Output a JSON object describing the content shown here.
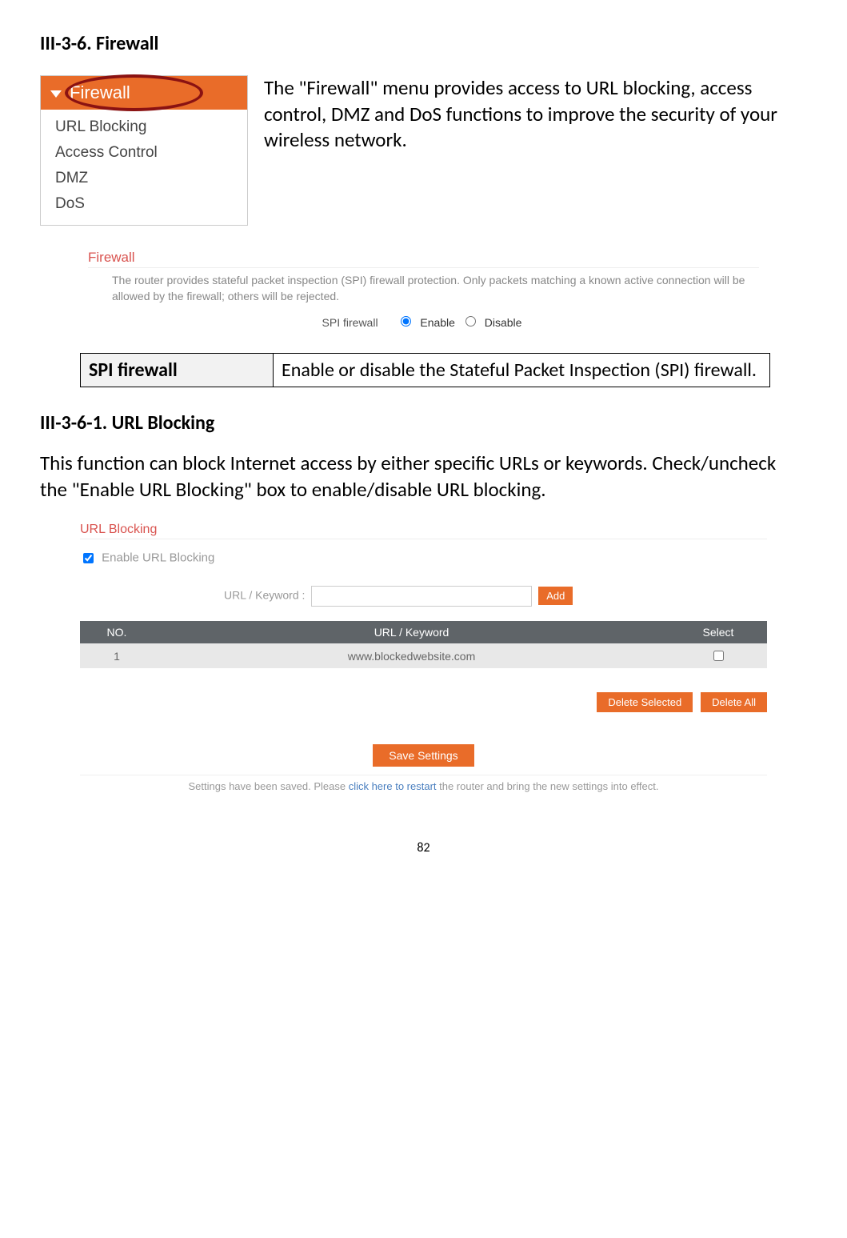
{
  "headings": {
    "main": "III-3-6. Firewall",
    "sub": "III-3-6-1.    URL Blocking"
  },
  "menu": {
    "header": "Firewall",
    "items": [
      "URL Blocking",
      "Access Control",
      "DMZ",
      "DoS"
    ]
  },
  "intro_text": "The \"Firewall\" menu provides access to URL blocking, access control, DMZ and DoS functions to improve the security of your wireless network.",
  "firewall_panel": {
    "title": "Firewall",
    "desc": "The router provides stateful packet inspection (SPI) firewall protection. Only packets matching a known active connection will be allowed by the firewall; others will be rejected.",
    "spi_label": "SPI firewall",
    "enable": "Enable",
    "disable": "Disable"
  },
  "def_table": {
    "term": "SPI firewall",
    "definition": "Enable or disable the Stateful Packet Inspection (SPI) firewall."
  },
  "url_intro": "This function can block Internet access by either specific URLs or keywords. Check/uncheck the \"Enable URL Blocking\" box to enable/disable URL blocking.",
  "url_panel": {
    "title": "URL Blocking",
    "enable_label": "Enable URL Blocking",
    "input_label": "URL / Keyword :",
    "add_btn": "Add",
    "headers": {
      "no": "NO.",
      "url": "URL / Keyword",
      "select": "Select"
    },
    "rows": [
      {
        "no": "1",
        "url": "www.blockedwebsite.com"
      }
    ],
    "delete_selected": "Delete Selected",
    "delete_all": "Delete All",
    "save_btn": "Save Settings",
    "restart_pre": "Settings have been saved. Please",
    "restart_link": " click here to restart ",
    "restart_post": "the router and bring the new settings into effect."
  },
  "page_number": "82"
}
